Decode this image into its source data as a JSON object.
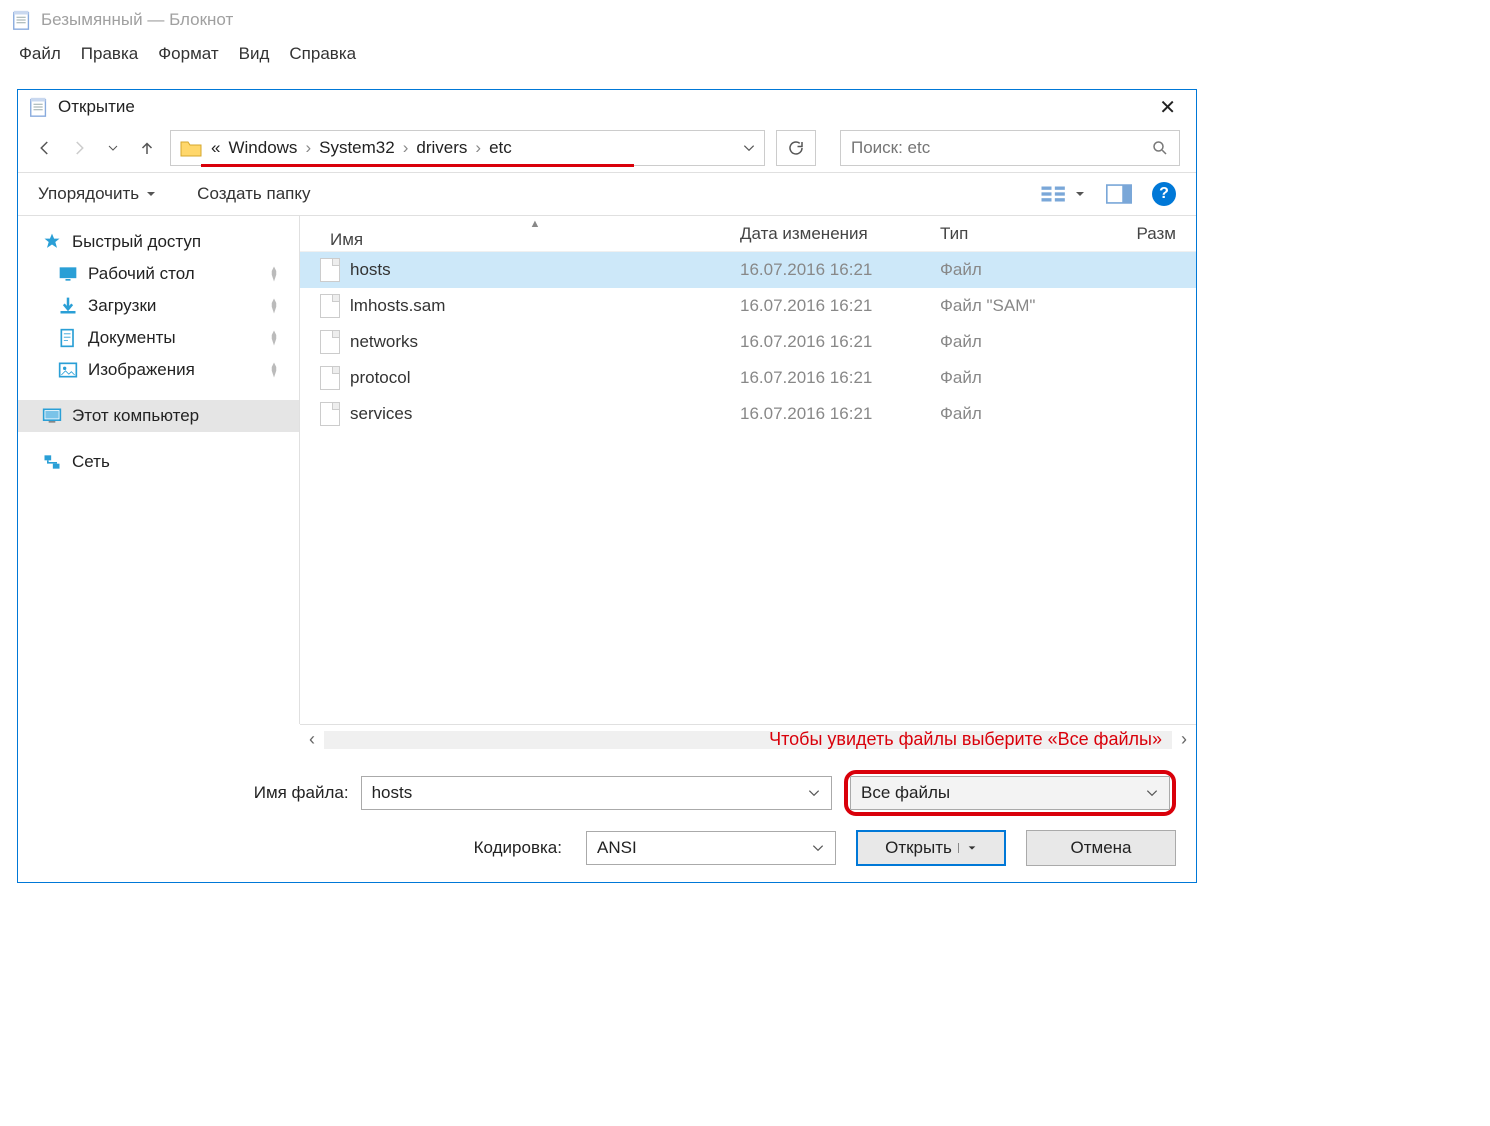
{
  "app": {
    "title": "Безымянный — Блокнот"
  },
  "menu": {
    "items": [
      "Файл",
      "Правка",
      "Формат",
      "Вид",
      "Справка"
    ]
  },
  "dialog": {
    "title": "Открытие",
    "search_placeholder": "Поиск: etc",
    "breadcrumb": {
      "prefix": "«",
      "parts": [
        "Windows",
        "System32",
        "drivers",
        "etc"
      ]
    }
  },
  "toolbar": {
    "organize": "Упорядочить",
    "new_folder": "Создать папку"
  },
  "sidebar": {
    "quick_access": "Быстрый доступ",
    "items": [
      {
        "label": "Рабочий стол"
      },
      {
        "label": "Загрузки"
      },
      {
        "label": "Документы"
      },
      {
        "label": "Изображения"
      }
    ],
    "this_pc": "Этот компьютер",
    "network": "Сеть"
  },
  "columns": {
    "name": "Имя",
    "date": "Дата изменения",
    "type": "Тип",
    "size": "Разм"
  },
  "files": [
    {
      "name": "hosts",
      "date": "16.07.2016 16:21",
      "type": "Файл",
      "selected": true
    },
    {
      "name": "lmhosts.sam",
      "date": "16.07.2016 16:21",
      "type": "Файл \"SAM\"",
      "selected": false
    },
    {
      "name": "networks",
      "date": "16.07.2016 16:21",
      "type": "Файл",
      "selected": false
    },
    {
      "name": "protocol",
      "date": "16.07.2016 16:21",
      "type": "Файл",
      "selected": false
    },
    {
      "name": "services",
      "date": "16.07.2016 16:21",
      "type": "Файл",
      "selected": false
    }
  ],
  "annotation": "Чтобы увидеть файлы выберите «Все файлы»",
  "footer": {
    "filename_label": "Имя файла:",
    "filename_value": "hosts",
    "filetype_value": "Все файлы",
    "encoding_label": "Кодировка:",
    "encoding_value": "ANSI",
    "open": "Открыть",
    "cancel": "Отмена"
  }
}
